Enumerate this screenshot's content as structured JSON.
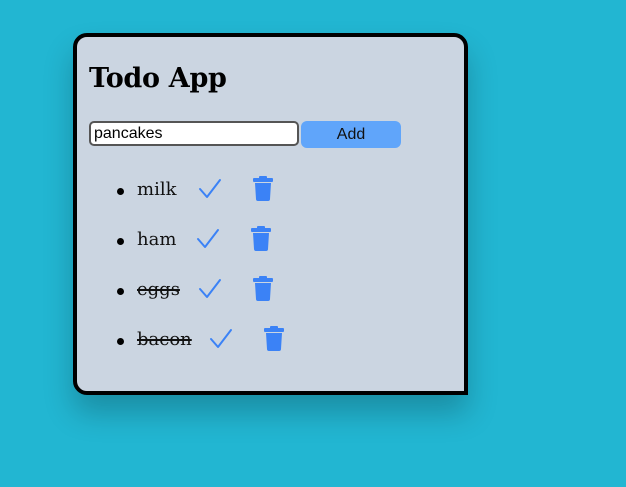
{
  "app": {
    "title": "Todo App"
  },
  "input": {
    "value": "pancakes",
    "placeholder": ""
  },
  "add_button": {
    "label": "Add"
  },
  "todos": [
    {
      "text": "milk",
      "completed": false
    },
    {
      "text": "ham",
      "completed": false
    },
    {
      "text": "eggs",
      "completed": true
    },
    {
      "text": "bacon",
      "completed": true
    }
  ],
  "icons": {
    "complete": "check-icon",
    "delete": "trash-icon"
  },
  "colors": {
    "page_background": "#22b6d2",
    "card_background": "#cbd5e1",
    "add_button": "#60a5fa",
    "icon_blue": "#3b82f6"
  }
}
